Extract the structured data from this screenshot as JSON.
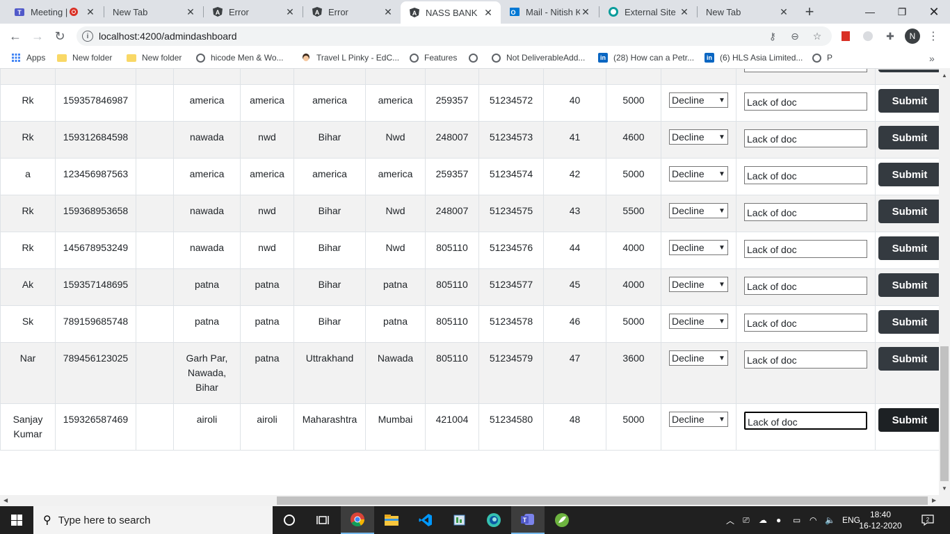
{
  "browser": {
    "tabs": [
      {
        "title": "Meeting |",
        "icon": "teams-icon",
        "recording": true
      },
      {
        "title": "New Tab",
        "icon": "none"
      },
      {
        "title": "Error",
        "icon": "angular-icon"
      },
      {
        "title": "Error",
        "icon": "angular-icon"
      },
      {
        "title": "NASS BANK",
        "icon": "angular-icon",
        "active": true
      },
      {
        "title": "Mail - Nitish K",
        "icon": "outlook-icon"
      },
      {
        "title": "External Site",
        "icon": "globe-icon"
      },
      {
        "title": "New Tab",
        "icon": "none"
      }
    ],
    "url": "localhost:4200/admindashboard",
    "profile_initial": "N",
    "bookmarks": [
      {
        "label": "Apps",
        "icon": "apps-grid-icon"
      },
      {
        "label": "New folder",
        "icon": "folder-icon"
      },
      {
        "label": "New folder",
        "icon": "folder-icon"
      },
      {
        "label": "hicode Men & Wo...",
        "icon": "globe-icon"
      },
      {
        "label": "Travel L Pinky - EdC...",
        "icon": "avatar-icon"
      },
      {
        "label": "Features",
        "icon": "globe-icon"
      },
      {
        "label": "",
        "icon": "globe-icon"
      },
      {
        "label": "Not DeliverableAdd...",
        "icon": "globe-icon"
      },
      {
        "label": "(28) How can a Petr...",
        "icon": "linkedin-icon"
      },
      {
        "label": "(6) HLS Asia Limited...",
        "icon": "linkedin-icon"
      },
      {
        "label": "P",
        "icon": "globe-icon"
      }
    ]
  },
  "table": {
    "rows": [
      {
        "name": "Rk",
        "account": "159357846987",
        "blank": "",
        "address": "america",
        "city": "america",
        "state": "america",
        "district": "america",
        "pin": "259357",
        "code": "51234572",
        "id": "40",
        "amount": "5000",
        "status": "Decline",
        "reason": "Lack of doc",
        "action": "Submit"
      },
      {
        "name": "Rk",
        "account": "159312684598",
        "blank": "",
        "address": "nawada",
        "city": "nwd",
        "state": "Bihar",
        "district": "Nwd",
        "pin": "248007",
        "code": "51234573",
        "id": "41",
        "amount": "4600",
        "status": "Decline",
        "reason": "Lack of doc",
        "action": "Submit"
      },
      {
        "name": "a",
        "account": "123456987563",
        "blank": "",
        "address": "america",
        "city": "america",
        "state": "america",
        "district": "america",
        "pin": "259357",
        "code": "51234574",
        "id": "42",
        "amount": "5000",
        "status": "Decline",
        "reason": "Lack of doc",
        "action": "Submit"
      },
      {
        "name": "Rk",
        "account": "159368953658",
        "blank": "",
        "address": "nawada",
        "city": "nwd",
        "state": "Bihar",
        "district": "Nwd",
        "pin": "248007",
        "code": "51234575",
        "id": "43",
        "amount": "5500",
        "status": "Decline",
        "reason": "Lack of doc",
        "action": "Submit"
      },
      {
        "name": "Rk",
        "account": "145678953249",
        "blank": "",
        "address": "nawada",
        "city": "nwd",
        "state": "Bihar",
        "district": "Nwd",
        "pin": "805110",
        "code": "51234576",
        "id": "44",
        "amount": "4000",
        "status": "Decline",
        "reason": "Lack of doc",
        "action": "Submit"
      },
      {
        "name": "Ak",
        "account": "159357148695",
        "blank": "",
        "address": "patna",
        "city": "patna",
        "state": "Bihar",
        "district": "patna",
        "pin": "805110",
        "code": "51234577",
        "id": "45",
        "amount": "4000",
        "status": "Decline",
        "reason": "Lack of doc",
        "action": "Submit"
      },
      {
        "name": "Sk",
        "account": "789159685748",
        "blank": "",
        "address": "patna",
        "city": "patna",
        "state": "Bihar",
        "district": "patna",
        "pin": "805110",
        "code": "51234578",
        "id": "46",
        "amount": "5000",
        "status": "Decline",
        "reason": "Lack of doc",
        "action": "Submit"
      },
      {
        "name": "Nar",
        "account": "789456123025",
        "blank": "",
        "address": "Garh Par, Nawada, Bihar",
        "city": "patna",
        "state": "Uttrakhand",
        "district": "Nawada",
        "pin": "805110",
        "code": "51234579",
        "id": "47",
        "amount": "3600",
        "status": "Decline",
        "reason": "Lack of doc",
        "action": "Submit"
      },
      {
        "name": "Sanjay Kumar",
        "account": "159326587469",
        "blank": "",
        "address": "airoli",
        "city": "airoli",
        "state": "Maharashtra",
        "district": "Mumbai",
        "pin": "421004",
        "code": "51234580",
        "id": "48",
        "amount": "5000",
        "status": "Decline",
        "reason": "Lack of doc",
        "action": "Submit"
      }
    ]
  },
  "taskbar": {
    "search_placeholder": "Type here to search",
    "language": "ENG",
    "time": "18:40",
    "date": "16-12-2020",
    "notification_count": "2",
    "apps": [
      "task-view-icon",
      "cortana-icon",
      "chrome-icon",
      "file-explorer-icon",
      "vscode-icon",
      "task-manager-icon",
      "edge-icon",
      "teams-icon",
      "spring-icon"
    ]
  },
  "colors": {
    "submit_button": "#343a40",
    "row_stripe": "#f2f2f2",
    "table_border": "#dee2e6"
  }
}
